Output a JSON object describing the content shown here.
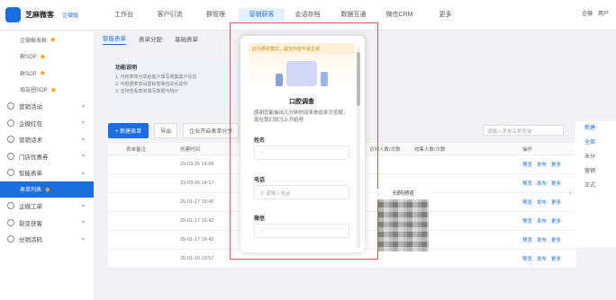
{
  "app": {
    "name": "芝麻微客",
    "sub": "企微版"
  },
  "nav": [
    "工作台",
    "客户引流",
    "群管理",
    "营销获客",
    "会话存档",
    "数据互通",
    "微信CRM",
    "更多"
  ],
  "nav_active_index": 3,
  "topright": {
    "brand": "企微",
    "user": "用户"
  },
  "sidebar": {
    "items": [
      {
        "label": "企微群发群",
        "type": "sub",
        "star": true
      },
      {
        "label": "群SOP",
        "type": "sub",
        "star": true
      },
      {
        "label": "群SOP",
        "type": "sub",
        "star": true
      },
      {
        "label": "朋友圈SOP",
        "type": "sub",
        "star": true
      },
      {
        "label": "营销活动",
        "type": "group"
      },
      {
        "label": "企微红包",
        "type": "group"
      },
      {
        "label": "营销话术",
        "type": "group"
      },
      {
        "label": "门店优惠券",
        "type": "group"
      },
      {
        "label": "智能表单",
        "type": "group"
      },
      {
        "label": "表单列表",
        "type": "sub",
        "active": true,
        "star": true
      },
      {
        "label": "企微工单",
        "type": "group"
      },
      {
        "label": "裂变获客",
        "type": "group"
      },
      {
        "label": "分销活码",
        "type": "group"
      }
    ]
  },
  "tabs": [
    "智能表单",
    "表单分配",
    "基础表单"
  ],
  "info": {
    "title": "功能说明",
    "lines": [
      "1. 可将表单分享给客户填写收集客户信息",
      "2. 可根据表单设置标签等自动化动作",
      "3. 支持查看表单填写数据与统计"
    ]
  },
  "toolbar": {
    "new_label": "+ 新建表单",
    "export_label": "导出",
    "batch_label": "企业开启表单分享"
  },
  "search_placeholder": "请输入表单名称查询",
  "table": {
    "headers": [
      "",
      "表单备注",
      "创建时间",
      "",
      "",
      "访问人数/次数",
      "收集人数/次数",
      "",
      "操作"
    ],
    "rows": [
      {
        "date": "23-03-26 14:58",
        "ops": [
          "预览",
          "发布",
          "更多"
        ]
      },
      {
        "date": "23-03-26 14:17",
        "ops": [
          "预览",
          "发布",
          "更多"
        ]
      },
      {
        "date": "25-01-17 16:42",
        "ops": [
          "预览",
          "发布",
          "更多"
        ]
      },
      {
        "date": "25-01-17 16:42",
        "ops": [
          "预览",
          "发布",
          "更多"
        ]
      },
      {
        "date": "25-01-17 16:42",
        "ops": [
          "预览",
          "发布",
          "更多"
        ]
      },
      {
        "date": "25-01-15 10:57",
        "ops": [
          "预览",
          "发布",
          "更多"
        ]
      }
    ]
  },
  "right_panel": [
    "新建",
    "全部",
    "未分",
    "营销",
    "正式"
  ],
  "modal": {
    "notice": "此为预览模式，提交内容不会生效",
    "title": "口腔调查",
    "desc": "感谢您能抽出几分钟时间来参加本次答题，现在我们就马上开始吧",
    "fields": [
      {
        "label": "姓名",
        "placeholder": ""
      },
      {
        "label": "电话",
        "placeholder": "请输入电话"
      },
      {
        "label": "微信",
        "placeholder": ""
      }
    ]
  },
  "qr_label": "扫码预览"
}
